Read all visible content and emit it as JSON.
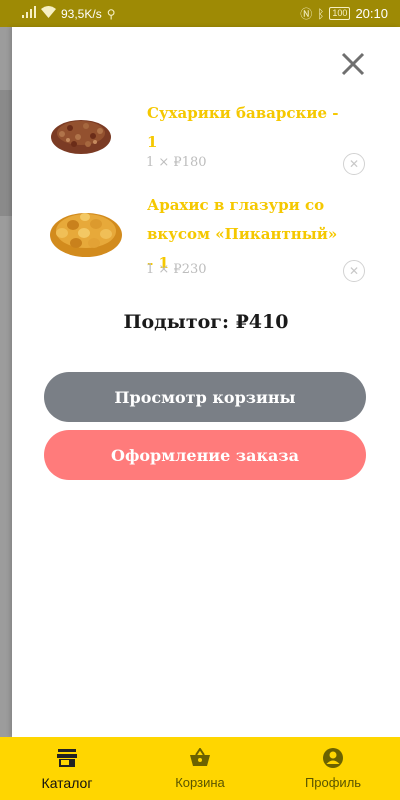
{
  "status_bar": {
    "speed": "93,5K/s",
    "battery": "100",
    "time": "20:10"
  },
  "cart": {
    "items": [
      {
        "name": "Сухарики баварские - 1",
        "qty_price": "1 × ₽180"
      },
      {
        "name": "Арахис в глазури со вкусом «Пикантный» - 1",
        "qty_price": "1 × ₽230"
      }
    ],
    "subtotal": "Подытог: ₽410",
    "view_cart_label": "Просмотр корзины",
    "checkout_label": "Оформление заказа"
  },
  "bottom_nav": {
    "items": [
      {
        "label": "Каталог",
        "icon": "store-icon",
        "active": true
      },
      {
        "label": "Корзина",
        "icon": "basket-icon",
        "active": false
      },
      {
        "label": "Профиль",
        "icon": "account-icon",
        "active": false
      }
    ]
  },
  "colors": {
    "status_bar": "#9e8a05",
    "product_name": "#f5c800",
    "view_cart_button": "#7a7f86",
    "checkout_button": "#ff7b7b",
    "bottom_nav": "#ffd600"
  }
}
